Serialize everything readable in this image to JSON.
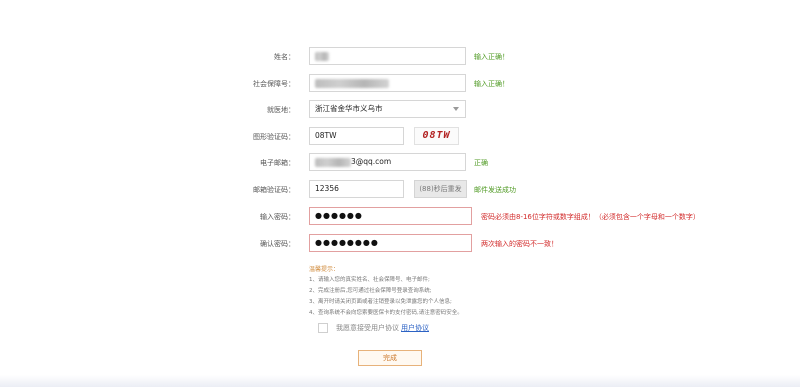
{
  "form": {
    "name": {
      "label": "姓名：",
      "status": "输入正确！"
    },
    "ssn": {
      "label": "社会保障号：",
      "status": "输入正确！"
    },
    "region": {
      "label": "就医地：",
      "value": "浙江省金华市义乌市"
    },
    "captcha": {
      "label": "图形验证码：",
      "value": "08TW",
      "image_text": "08TW"
    },
    "email": {
      "label": "电子邮箱：",
      "suffix": "3@qq.com",
      "status": "正确"
    },
    "email_code": {
      "label": "邮箱验证码：",
      "value": "12356",
      "resend_label": "(88)秒后重发",
      "status": "邮件发送成功"
    },
    "password": {
      "label": "输入密码：",
      "masked": "●●●●●●",
      "error": "密码必须由8-16位字符或数字组成！（必须包含一个字母和一个数字）"
    },
    "confirm": {
      "label": "确认密码：",
      "masked": "●●●●●●●●",
      "error": "两次输入的密码不一致！"
    }
  },
  "tips": {
    "title": "温馨提示：",
    "items": [
      "1、请输入您的真实姓名、社会保障号、电子邮件;",
      "2、完成注册后,您可通过社会保障号登录查询系统;",
      "3、离开时请关闭页面或者注销登录以免泄露您的个人信息;",
      "4、查询系统不会向您索要医保卡的支付密码,请注意密码安全。"
    ]
  },
  "agreement": {
    "text": "我愿意接受用户协议",
    "link": "用户协议"
  },
  "submit": {
    "label": "完成"
  },
  "colors": {
    "ok": "#4f9a23",
    "error": "#d22a2a",
    "accent": "#cc7a2e",
    "link": "#2c62c4"
  }
}
